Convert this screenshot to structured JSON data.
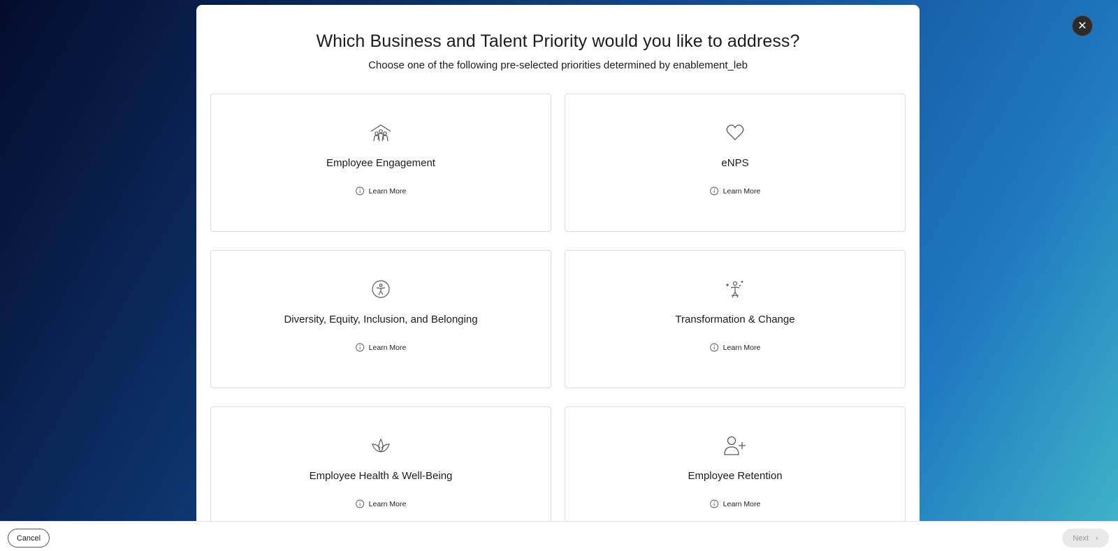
{
  "modal": {
    "title": "Which Business and Talent Priority would you like to address?",
    "subtitle": "Choose one of the following pre-selected priorities determined by enablement_leb",
    "close_icon": "close-icon",
    "learn_more_label": "Learn More",
    "cards": [
      {
        "title": "Employee Engagement",
        "icon": "community-house-icon",
        "learn_more": "Learn More"
      },
      {
        "title": "eNPS",
        "icon": "heart-icon",
        "learn_more": "Learn More"
      },
      {
        "title": "Diversity, Equity, Inclusion, and Belonging",
        "icon": "accessibility-person-icon",
        "learn_more": "Learn More"
      },
      {
        "title": "Transformation & Change",
        "icon": "sparkle-person-icon",
        "learn_more": "Learn More"
      },
      {
        "title": "Employee Health & Well-Being",
        "icon": "lotus-icon",
        "learn_more": "Learn More"
      },
      {
        "title": "Employee Retention",
        "icon": "add-person-icon",
        "learn_more": "Learn More"
      }
    ]
  },
  "footer": {
    "cancel_label": "Cancel",
    "next_label": "Next"
  },
  "colors": {
    "text": "#1c1c1c",
    "card_border": "#dcdcdc",
    "icon_stroke": "#555a66",
    "next_disabled_bg": "#e9e9e9",
    "next_disabled_text": "#9a9a9a"
  }
}
